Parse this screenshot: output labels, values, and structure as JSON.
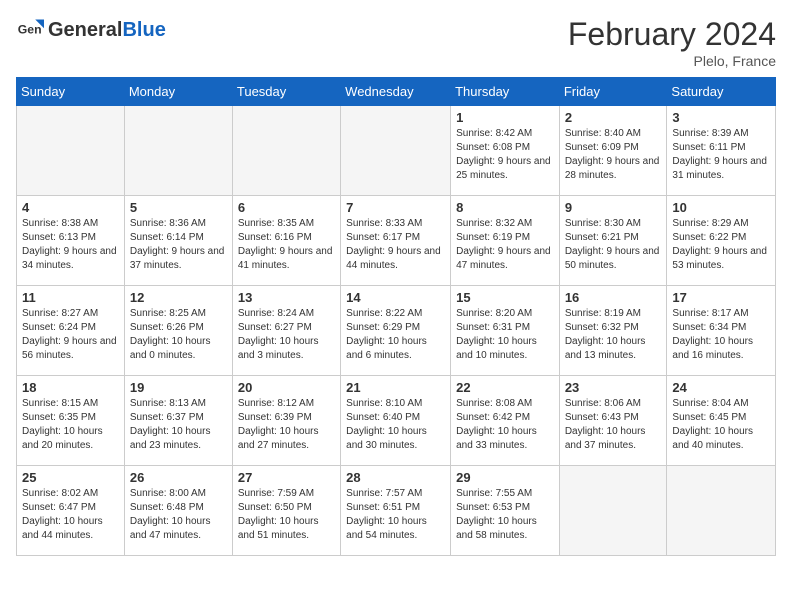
{
  "header": {
    "logo_general": "General",
    "logo_blue": "Blue",
    "title": "February 2024",
    "subtitle": "Plelo, France"
  },
  "weekdays": [
    "Sunday",
    "Monday",
    "Tuesday",
    "Wednesday",
    "Thursday",
    "Friday",
    "Saturday"
  ],
  "weeks": [
    [
      {
        "day": "",
        "info": ""
      },
      {
        "day": "",
        "info": ""
      },
      {
        "day": "",
        "info": ""
      },
      {
        "day": "",
        "info": ""
      },
      {
        "day": "1",
        "info": "Sunrise: 8:42 AM\nSunset: 6:08 PM\nDaylight: 9 hours and 25 minutes."
      },
      {
        "day": "2",
        "info": "Sunrise: 8:40 AM\nSunset: 6:09 PM\nDaylight: 9 hours and 28 minutes."
      },
      {
        "day": "3",
        "info": "Sunrise: 8:39 AM\nSunset: 6:11 PM\nDaylight: 9 hours and 31 minutes."
      }
    ],
    [
      {
        "day": "4",
        "info": "Sunrise: 8:38 AM\nSunset: 6:13 PM\nDaylight: 9 hours and 34 minutes."
      },
      {
        "day": "5",
        "info": "Sunrise: 8:36 AM\nSunset: 6:14 PM\nDaylight: 9 hours and 37 minutes."
      },
      {
        "day": "6",
        "info": "Sunrise: 8:35 AM\nSunset: 6:16 PM\nDaylight: 9 hours and 41 minutes."
      },
      {
        "day": "7",
        "info": "Sunrise: 8:33 AM\nSunset: 6:17 PM\nDaylight: 9 hours and 44 minutes."
      },
      {
        "day": "8",
        "info": "Sunrise: 8:32 AM\nSunset: 6:19 PM\nDaylight: 9 hours and 47 minutes."
      },
      {
        "day": "9",
        "info": "Sunrise: 8:30 AM\nSunset: 6:21 PM\nDaylight: 9 hours and 50 minutes."
      },
      {
        "day": "10",
        "info": "Sunrise: 8:29 AM\nSunset: 6:22 PM\nDaylight: 9 hours and 53 minutes."
      }
    ],
    [
      {
        "day": "11",
        "info": "Sunrise: 8:27 AM\nSunset: 6:24 PM\nDaylight: 9 hours and 56 minutes."
      },
      {
        "day": "12",
        "info": "Sunrise: 8:25 AM\nSunset: 6:26 PM\nDaylight: 10 hours and 0 minutes."
      },
      {
        "day": "13",
        "info": "Sunrise: 8:24 AM\nSunset: 6:27 PM\nDaylight: 10 hours and 3 minutes."
      },
      {
        "day": "14",
        "info": "Sunrise: 8:22 AM\nSunset: 6:29 PM\nDaylight: 10 hours and 6 minutes."
      },
      {
        "day": "15",
        "info": "Sunrise: 8:20 AM\nSunset: 6:31 PM\nDaylight: 10 hours and 10 minutes."
      },
      {
        "day": "16",
        "info": "Sunrise: 8:19 AM\nSunset: 6:32 PM\nDaylight: 10 hours and 13 minutes."
      },
      {
        "day": "17",
        "info": "Sunrise: 8:17 AM\nSunset: 6:34 PM\nDaylight: 10 hours and 16 minutes."
      }
    ],
    [
      {
        "day": "18",
        "info": "Sunrise: 8:15 AM\nSunset: 6:35 PM\nDaylight: 10 hours and 20 minutes."
      },
      {
        "day": "19",
        "info": "Sunrise: 8:13 AM\nSunset: 6:37 PM\nDaylight: 10 hours and 23 minutes."
      },
      {
        "day": "20",
        "info": "Sunrise: 8:12 AM\nSunset: 6:39 PM\nDaylight: 10 hours and 27 minutes."
      },
      {
        "day": "21",
        "info": "Sunrise: 8:10 AM\nSunset: 6:40 PM\nDaylight: 10 hours and 30 minutes."
      },
      {
        "day": "22",
        "info": "Sunrise: 8:08 AM\nSunset: 6:42 PM\nDaylight: 10 hours and 33 minutes."
      },
      {
        "day": "23",
        "info": "Sunrise: 8:06 AM\nSunset: 6:43 PM\nDaylight: 10 hours and 37 minutes."
      },
      {
        "day": "24",
        "info": "Sunrise: 8:04 AM\nSunset: 6:45 PM\nDaylight: 10 hours and 40 minutes."
      }
    ],
    [
      {
        "day": "25",
        "info": "Sunrise: 8:02 AM\nSunset: 6:47 PM\nDaylight: 10 hours and 44 minutes."
      },
      {
        "day": "26",
        "info": "Sunrise: 8:00 AM\nSunset: 6:48 PM\nDaylight: 10 hours and 47 minutes."
      },
      {
        "day": "27",
        "info": "Sunrise: 7:59 AM\nSunset: 6:50 PM\nDaylight: 10 hours and 51 minutes."
      },
      {
        "day": "28",
        "info": "Sunrise: 7:57 AM\nSunset: 6:51 PM\nDaylight: 10 hours and 54 minutes."
      },
      {
        "day": "29",
        "info": "Sunrise: 7:55 AM\nSunset: 6:53 PM\nDaylight: 10 hours and 58 minutes."
      },
      {
        "day": "",
        "info": ""
      },
      {
        "day": "",
        "info": ""
      }
    ]
  ]
}
